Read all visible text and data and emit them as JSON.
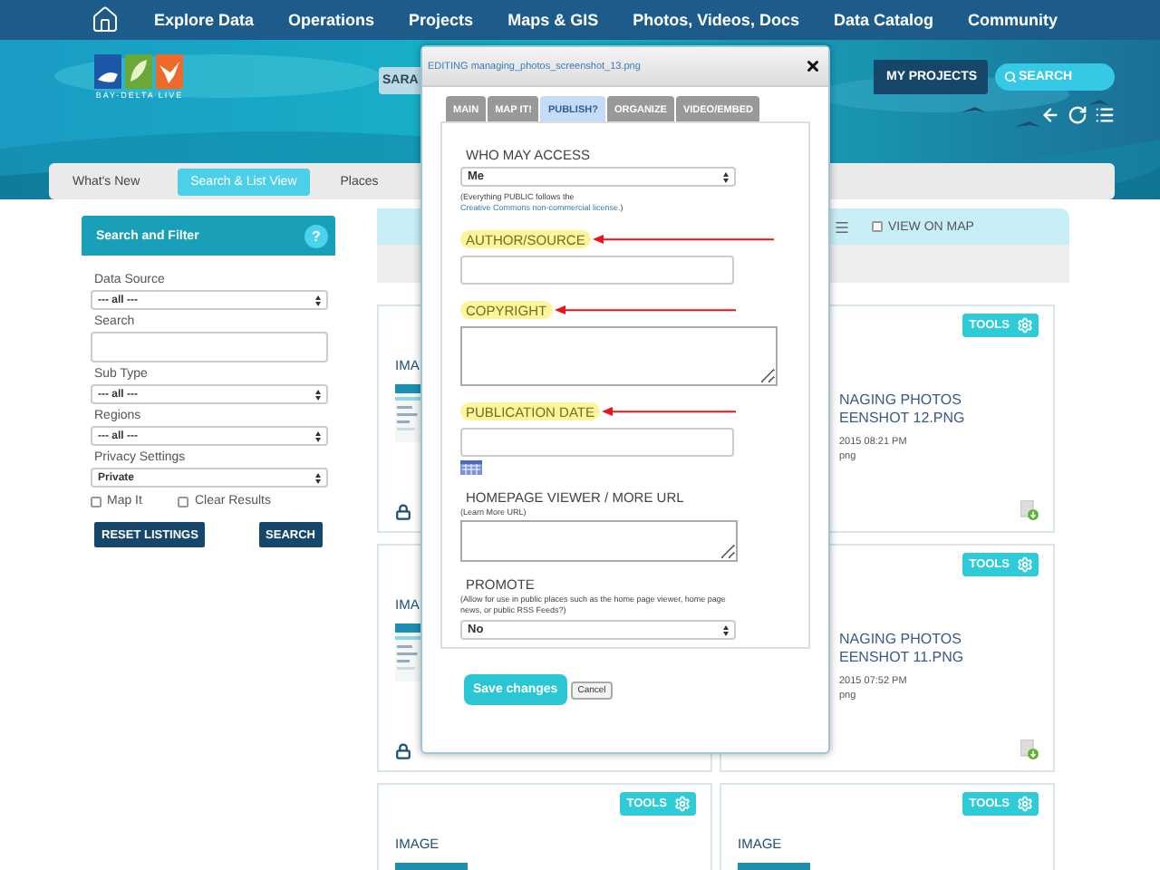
{
  "nav": {
    "items": [
      "Explore Data",
      "Operations",
      "Projects",
      "Maps & GIS",
      "Photos, Videos, Docs",
      "Data Catalog",
      "Community"
    ]
  },
  "header": {
    "logo_text": "BAY-DELTA LIVE",
    "user_button": "SARA",
    "projects_button": "MY PROJECTS",
    "search_button": "SEARCH"
  },
  "subnav": [
    {
      "label": "What's New",
      "selected": false
    },
    {
      "label": "Search & List View",
      "selected": true
    },
    {
      "label": "Places",
      "selected": false
    }
  ],
  "sidebar": {
    "title": "Search and Filter",
    "help": "?",
    "fields": [
      {
        "label": "Data Source",
        "kind": "select",
        "value": "--- all ---"
      },
      {
        "label": "Search",
        "kind": "input"
      },
      {
        "label": "Sub Type",
        "kind": "select",
        "value": "--- all ---"
      },
      {
        "label": "Regions",
        "kind": "select",
        "value": "--- all ---"
      },
      {
        "label": "Privacy Settings",
        "kind": "select",
        "value": "Private"
      }
    ],
    "checkboxes": [
      {
        "label": "Map It",
        "checked": false
      },
      {
        "label": "Clear Results",
        "checked": false
      }
    ],
    "buttons": [
      "RESET LISTINGS",
      "SEARCH"
    ]
  },
  "results": {
    "view_on_map": {
      "label": "VIEW ON MAP",
      "checked": false
    },
    "cards": [
      {
        "type": "IMA",
        "locked": true
      },
      {
        "tools": "TOOLS",
        "title": [
          "NAGING PHOTOS",
          "EENSHOT 12.PNG"
        ],
        "date": "2015 08:21 PM",
        "file_type": "png",
        "locked": false
      },
      {
        "type": "IMA",
        "locked": true
      },
      {
        "tools": "TOOLS",
        "title": [
          "NAGING PHOTOS",
          "EENSHOT 11.PNG"
        ],
        "date": "2015 07:52 PM",
        "file_type": "png",
        "locked": false
      },
      {
        "tools": "TOOLS",
        "type": "IMAGE",
        "locked": false
      },
      {
        "tools": "TOOLS",
        "type": "IMAGE",
        "locked": false
      }
    ]
  },
  "modal": {
    "title": "EDITING managing_photos_screenshot_13.png",
    "tabs": [
      {
        "label": "MAIN",
        "selected": false
      },
      {
        "label": "MAP IT!",
        "selected": false
      },
      {
        "label": "PUBLISH?",
        "selected": true
      },
      {
        "label": "ORGANIZE",
        "selected": false
      },
      {
        "label": "VIDEO/EMBED",
        "selected": false
      }
    ],
    "fields": [
      {
        "label": "WHO MAY ACCESS",
        "kind": "select",
        "value": "Me",
        "note": "(Everything PUBLIC follows the ",
        "note_link": "Creative Commons non-commercial license.",
        "note_end": ")",
        "highlighted": false
      },
      {
        "label": "AUTHOR/SOURCE",
        "kind": "input",
        "highlighted": true
      },
      {
        "label": "COPYRIGHT",
        "kind": "textarea",
        "highlighted": true
      },
      {
        "label": "PUBLICATION DATE",
        "kind": "date",
        "highlighted": true
      },
      {
        "label": "HOMEPAGE VIEWER / MORE URL",
        "kind": "textarea",
        "hint": "(Learn More URL)",
        "highlighted": false
      },
      {
        "label": "PROMOTE",
        "kind": "select",
        "hint": "(Allow for use in public places such as the home page viewer, home page news, or public RSS Feeds?)",
        "value": "No",
        "highlighted": false
      }
    ],
    "save_button": "Save changes",
    "cancel_button": "Cancel"
  }
}
